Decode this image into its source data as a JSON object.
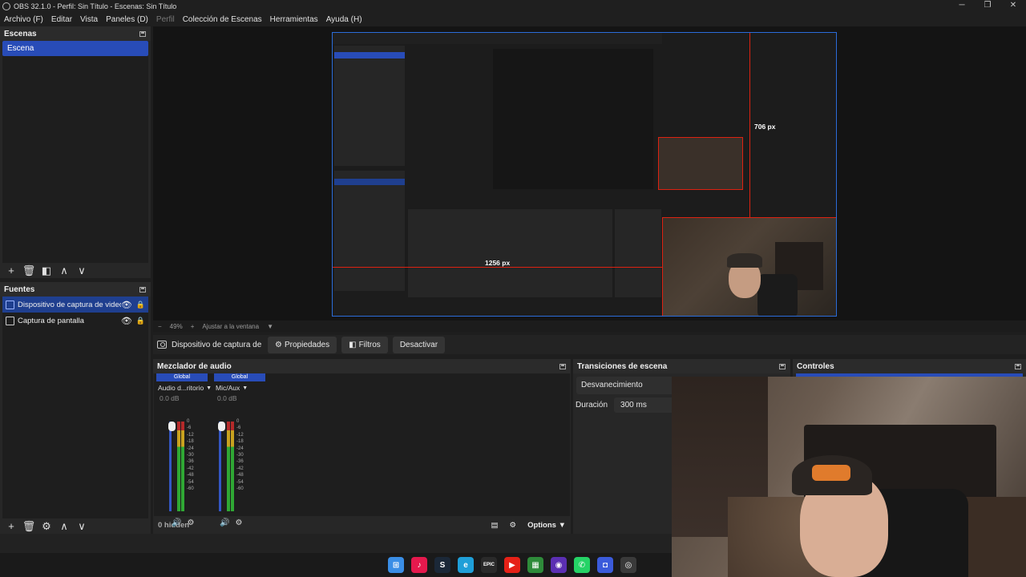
{
  "window": {
    "title": "OBS 32.1.0 - Perfil: Sin Título - Escenas: Sin Título",
    "controls": {
      "minimize": "─",
      "maximize": "❐",
      "close": "✕"
    }
  },
  "menu": {
    "items": [
      "Archivo (F)",
      "Editar",
      "Vista",
      "Paneles (D)",
      "Perfil",
      "Colección de Escenas",
      "Herramientas",
      "Ayuda (H)"
    ]
  },
  "scenes": {
    "title": "Escenas",
    "items": [
      "Escena"
    ]
  },
  "sources": {
    "title": "Fuentes",
    "items": [
      "Dispositivo de captura de video",
      "Captura de pantalla"
    ]
  },
  "toolbar_glyphs": {
    "add": "+",
    "remove": "🗑",
    "filter": "◧",
    "up": "∧",
    "down": "∨",
    "settings": "⚙"
  },
  "preview": {
    "guide_h_label": "1256 px",
    "guide_v_label": "706 px",
    "zoom": "49%",
    "zoom_minus": "−",
    "zoom_plus": "+",
    "fit_label": "Ajustar a la ventana"
  },
  "context_bar": {
    "source_name": "Dispositivo de captura de v",
    "properties": "Propiedades",
    "filters": "Filtros",
    "deactivate": "Desactivar"
  },
  "mixer": {
    "title": "Mezclador de audio",
    "channels": [
      {
        "tag": "Global",
        "name": "Audio d...ritorio",
        "db": "0.0 dB"
      },
      {
        "tag": "Global",
        "name": "Mic/Aux",
        "db": "0.0 dB"
      }
    ],
    "scale": [
      "0",
      "-6",
      "-12",
      "-18",
      "-24",
      "-30",
      "-36",
      "-42",
      "-48",
      "-54",
      "-60"
    ],
    "hidden": "0 hidden",
    "options": "Options"
  },
  "transitions": {
    "title": "Transiciones de escena",
    "selected": "Desvanecimiento",
    "duration_label": "Duración",
    "duration_value": "300 ms"
  },
  "controls_dock": {
    "title": "Controles"
  },
  "taskbar": {
    "icons": [
      {
        "name": "windows-start-icon",
        "color": "#3a8ee6",
        "glyph": "⊞"
      },
      {
        "name": "tiktok-icon",
        "color": "#e5194d",
        "glyph": "♪"
      },
      {
        "name": "steam-icon",
        "color": "#1b2838",
        "glyph": "S"
      },
      {
        "name": "edge-icon",
        "color": "#1f9fd8",
        "glyph": "e"
      },
      {
        "name": "epic-games-icon",
        "color": "#2a2a2a",
        "glyph": "EPIC"
      },
      {
        "name": "youtube-music-icon",
        "color": "#e62117",
        "glyph": "▶"
      },
      {
        "name": "minecraft-icon",
        "color": "#2e8b3a",
        "glyph": "▦"
      },
      {
        "name": "obs-studio-icon",
        "color": "#5b2fb3",
        "glyph": "◉"
      },
      {
        "name": "whatsapp-icon",
        "color": "#25d366",
        "glyph": "✆"
      },
      {
        "name": "discord-icon",
        "color": "#3b5bdb",
        "glyph": "◘"
      },
      {
        "name": "obs-icon",
        "color": "#3a3a3a",
        "glyph": "◎"
      }
    ]
  }
}
